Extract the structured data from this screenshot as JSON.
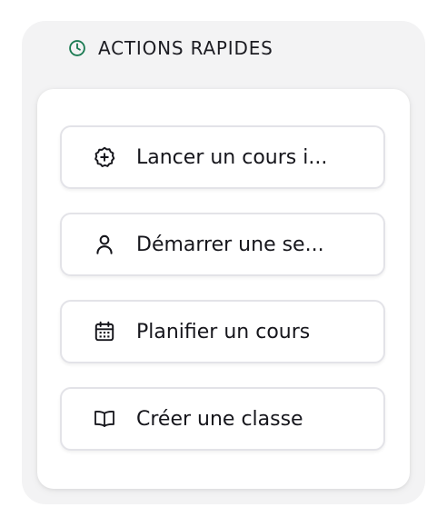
{
  "panel": {
    "title": "ACTIONS RAPIDES",
    "title_icon": "clock-icon"
  },
  "actions": [
    {
      "label": "Lancer un cours i...",
      "icon": "plus-badge-icon"
    },
    {
      "label": "Démarrer une se...",
      "icon": "user-icon"
    },
    {
      "label": "Planifier un cours",
      "icon": "calendar-icon"
    },
    {
      "label": "Créer une classe",
      "icon": "book-open-icon"
    }
  ],
  "colors": {
    "accent": "#1a7a52",
    "panel_bg": "#f3f3f4",
    "text": "#16161c"
  }
}
